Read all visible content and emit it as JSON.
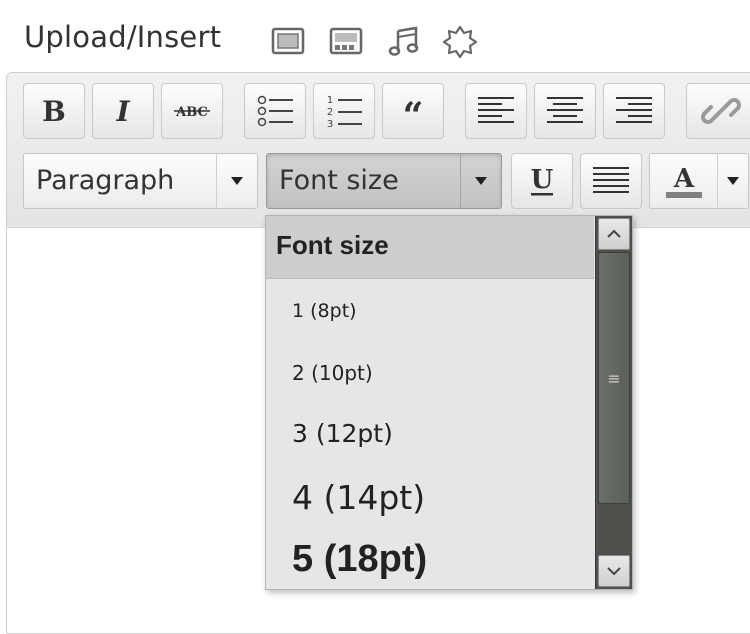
{
  "upload": {
    "label": "Upload/Insert",
    "icons": [
      "image-icon",
      "video-icon",
      "music-icon",
      "media-icon"
    ]
  },
  "toolbar": {
    "row1": [
      "bold-icon",
      "italic-icon",
      "strikethrough-icon",
      "bullet-list-icon",
      "numbered-list-icon",
      "blockquote-icon",
      "align-left-icon",
      "align-center-icon",
      "align-right-icon",
      "link-icon"
    ],
    "format_select": "Paragraph",
    "font_size_select": "Font size"
  },
  "font_menu": {
    "title": "Font size",
    "items": [
      "1 (8pt)",
      "2 (10pt)",
      "3 (12pt)",
      "4 (14pt)",
      "5 (18pt)"
    ],
    "scroll_grip": "≡"
  },
  "colors": {
    "menu_bg": "#e6e6e6",
    "scrollbar": "#4e514c",
    "toolbar": "#e9e9e9"
  }
}
